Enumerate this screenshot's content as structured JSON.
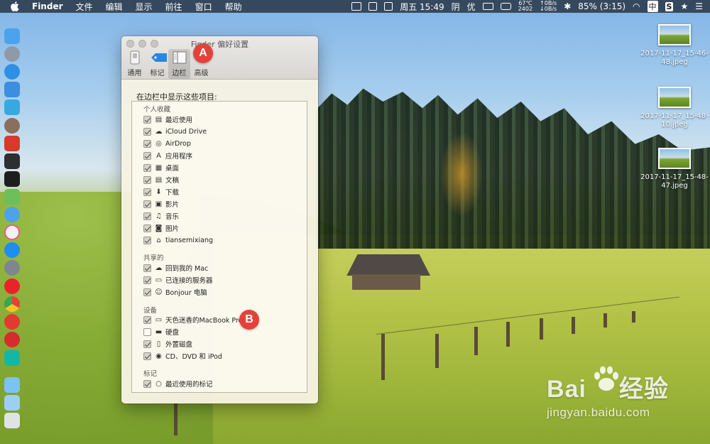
{
  "menubar": {
    "app_name": "Finder",
    "menus": [
      "文件",
      "编辑",
      "显示",
      "前往",
      "窗口",
      "帮助"
    ],
    "status": {
      "temp": "67℃",
      "fan": "2402",
      "net_up": "↑0B/s",
      "net_down": "↓0B/s",
      "clock": "周五 15:49",
      "weather": "阴",
      "air": "优",
      "battery": "85% (3:15)",
      "input_method": "中",
      "s_badge": "S"
    }
  },
  "desktop_files": [
    {
      "name": "2017-11-17_15-46-48.jpeg"
    },
    {
      "name": "2017-11-17_15-48-10.jpeg"
    },
    {
      "name": "2017-11-17_15-48-47.jpeg"
    }
  ],
  "window": {
    "title": "Finder 偏好设置",
    "tabs": [
      {
        "label": "通用",
        "icon": "switch-icon"
      },
      {
        "label": "标记",
        "icon": "tag-icon"
      },
      {
        "label": "边栏",
        "icon": "sidebar-icon",
        "active": true
      },
      {
        "label": "高级",
        "icon": "gear-icon"
      }
    ],
    "heading": "在边栏中显示这些项目:",
    "groups": {
      "favorites": {
        "title": "个人收藏",
        "items": [
          {
            "label": "最近使用",
            "checked": true,
            "icon": "recents-icon"
          },
          {
            "label": "iCloud Drive",
            "checked": true,
            "icon": "cloud-icon"
          },
          {
            "label": "AirDrop",
            "checked": true,
            "icon": "airdrop-icon"
          },
          {
            "label": "应用程序",
            "checked": true,
            "icon": "applications-icon"
          },
          {
            "label": "桌面",
            "checked": true,
            "icon": "desktop-icon"
          },
          {
            "label": "文稿",
            "checked": true,
            "icon": "documents-icon"
          },
          {
            "label": "下载",
            "checked": true,
            "icon": "download-icon"
          },
          {
            "label": "影片",
            "checked": true,
            "icon": "movies-icon"
          },
          {
            "label": "音乐",
            "checked": true,
            "icon": "music-icon"
          },
          {
            "label": "图片",
            "checked": true,
            "icon": "camera-icon"
          },
          {
            "label": "tiansemixiang",
            "checked": true,
            "icon": "home-icon"
          }
        ]
      },
      "shared": {
        "title": "共享的",
        "items": [
          {
            "label": "回到我的 Mac",
            "checked": true,
            "icon": "cloud-icon"
          },
          {
            "label": "已连接的服务器",
            "checked": true,
            "icon": "display-icon"
          },
          {
            "label": "Bonjour 电脑",
            "checked": true,
            "icon": "bonjour-icon"
          }
        ]
      },
      "devices": {
        "title": "设备",
        "items": [
          {
            "label": "天色迷香的MacBook Pro",
            "checked": true,
            "icon": "laptop-icon"
          },
          {
            "label": "硬盘",
            "checked": false,
            "icon": "hard-disk-icon"
          },
          {
            "label": "外置磁盘",
            "checked": true,
            "icon": "external-disk-icon"
          },
          {
            "label": "CD、DVD 和 iPod",
            "checked": true,
            "icon": "disc-icon"
          }
        ]
      },
      "tags": {
        "title": "标记",
        "items": [
          {
            "label": "最近使用的标记",
            "checked": true,
            "icon": "tag-circle-icon"
          }
        ]
      }
    }
  },
  "callouts": {
    "a": "A",
    "b": "B"
  },
  "watermark": {
    "main": "Bai",
    "main2": "经验",
    "sub": "jingyan.baidu.com"
  },
  "colors": {
    "callout": "#e2423a",
    "accent_blue": "#2b86e0"
  }
}
